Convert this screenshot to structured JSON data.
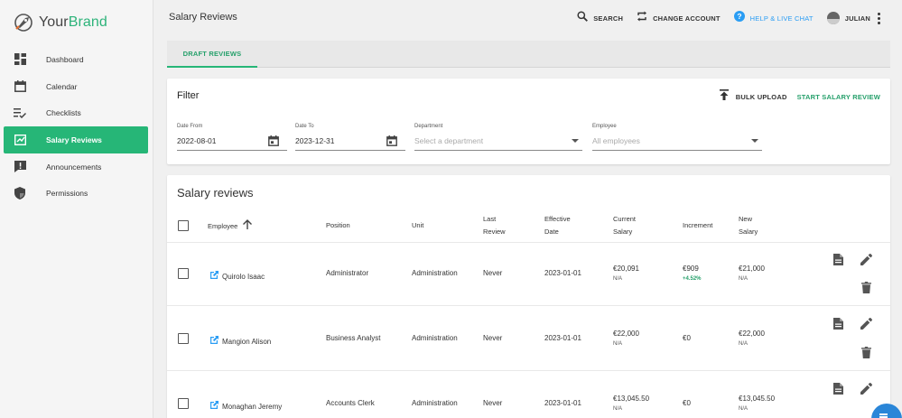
{
  "brand": {
    "name_part1": "Your",
    "name_part2": "Brand",
    "accent_color": "#2db37a"
  },
  "sidebar": {
    "items": [
      {
        "label": "Dashboard",
        "icon": "dashboard-icon"
      },
      {
        "label": "Calendar",
        "icon": "calendar-icon"
      },
      {
        "label": "Checklists",
        "icon": "checklist-icon"
      },
      {
        "label": "Salary Reviews",
        "icon": "salary-review-icon",
        "active": true
      },
      {
        "label": "Announcements",
        "icon": "announcement-icon"
      },
      {
        "label": "Permissions",
        "icon": "shield-icon"
      }
    ],
    "active_color": "#26b677"
  },
  "header": {
    "title": "Salary Reviews",
    "search_label": "SEARCH",
    "change_account_label": "CHANGE ACCOUNT",
    "help_label": "HELP & LIVE CHAT",
    "user_label": "JULIAN"
  },
  "tabs": [
    {
      "label": "DRAFT REVIEWS",
      "active": true
    }
  ],
  "filter": {
    "title": "Filter",
    "bulk_upload_label": "BULK UPLOAD",
    "start_review_label": "START SALARY REVIEW",
    "date_from": {
      "label": "Date From",
      "value": "2022-08-01"
    },
    "date_to": {
      "label": "Date To",
      "value": "2023-12-31"
    },
    "department": {
      "label": "Department",
      "placeholder": "Select a department"
    },
    "employee": {
      "label": "Employee",
      "placeholder": "All employees"
    }
  },
  "reviews": {
    "title": "Salary reviews",
    "columns": {
      "employee": "Employee",
      "position": "Position",
      "unit": "Unit",
      "last_review_1": "Last",
      "last_review_2": "Review",
      "effective_1": "Effective",
      "effective_2": "Date",
      "current_1": "Current",
      "current_2": "Salary",
      "increment": "Increment",
      "new_1": "New",
      "new_2": "Salary"
    },
    "rows": [
      {
        "employee": "Quirolo Isaac",
        "position": "Administrator",
        "unit": "Administration",
        "last_review": "Never",
        "effective_date": "2023-01-01",
        "current_salary": "€20,091",
        "current_sub": "N/A",
        "increment": "€909",
        "increment_pct": "+4.52%",
        "new_salary": "€21,000",
        "new_sub": "N/A"
      },
      {
        "employee": "Mangion Alison",
        "position": "Business Analyst",
        "unit": "Administration",
        "last_review": "Never",
        "effective_date": "2023-01-01",
        "current_salary": "€22,000",
        "current_sub": "N/A",
        "increment": "€0",
        "increment_pct": "",
        "new_salary": "€22,000",
        "new_sub": "N/A"
      },
      {
        "employee": "Monaghan Jeremy",
        "position": "Accounts Clerk",
        "unit": "Administration",
        "last_review": "Never",
        "effective_date": "2023-01-01",
        "current_salary": "€13,045.50",
        "current_sub": "N/A",
        "increment": "€0",
        "increment_pct": "",
        "new_salary": "€13,045.50",
        "new_sub": "N/A"
      }
    ]
  }
}
